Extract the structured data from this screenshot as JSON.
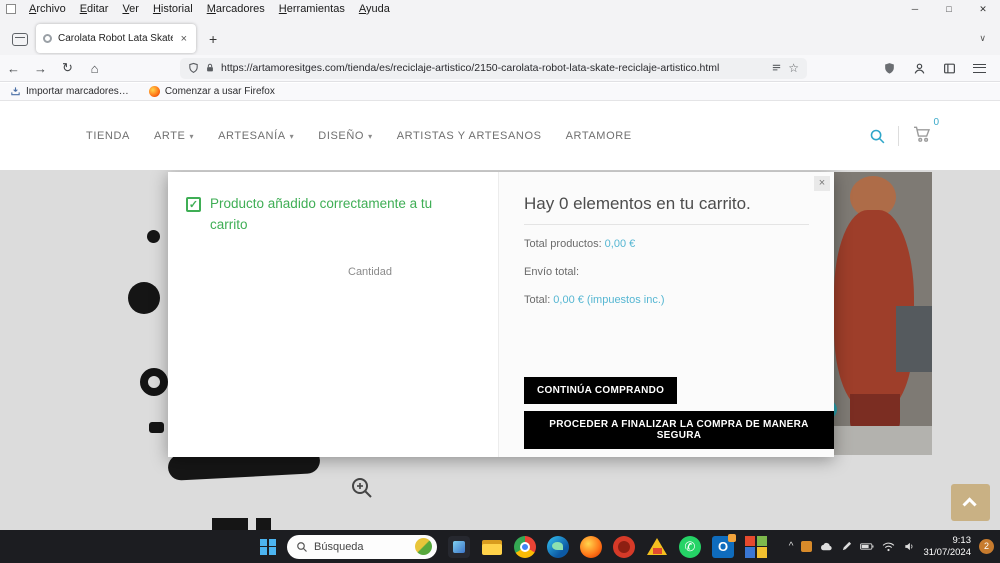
{
  "window": {
    "menu": [
      "Archivo",
      "Editar",
      "Ver",
      "Historial",
      "Marcadores",
      "Herramientas",
      "Ayuda"
    ],
    "controls": {
      "minimize": "─",
      "maximize": "□",
      "close": "✕"
    }
  },
  "browser": {
    "tab": {
      "title": "Carolata Robot Lata Skate Recic"
    },
    "url": "https://artamoresitges.com/tienda/es/reciclaje-artistico/2150-carolata-robot-lata-skate-reciclaje-artistico.html",
    "bookmarks": [
      {
        "label": "Importar marcadores…"
      },
      {
        "label": "Comenzar a usar Firefox"
      }
    ]
  },
  "site": {
    "nav": [
      {
        "label": "TIENDA",
        "caret": false
      },
      {
        "label": "ARTE",
        "caret": true
      },
      {
        "label": "ARTESANÍA",
        "caret": true
      },
      {
        "label": "DISEÑO",
        "caret": true
      },
      {
        "label": "ARTISTAS Y ARTESANOS",
        "caret": false
      },
      {
        "label": "ARTAMORE",
        "caret": false
      }
    ],
    "cart_count": "0"
  },
  "modal": {
    "success_message": "Producto añadido correctamente a tu carrito",
    "quantity_label": "Cantidad",
    "cart_title": "Hay 0 elementos en tu carrito.",
    "totals": [
      {
        "label": "Total productos:",
        "value": "0,00 €"
      },
      {
        "label": "Envío total:",
        "value": ""
      },
      {
        "label": "Total:",
        "value": "0,00 € (impuestos inc.)"
      }
    ],
    "continue_button": "CONTINÚA COMPRANDO",
    "checkout_button": "PROCEDER A FINALIZAR LA COMPRA DE MANERA SEGURA"
  },
  "taskbar": {
    "search_label": "Búsqueda",
    "time": "9:13",
    "date": "31/07/2024",
    "notification_count": "2"
  },
  "icons": {
    "back": "←",
    "forward": "→",
    "reload": "↻",
    "home": "⌂",
    "star": "☆",
    "plus": "+",
    "close": "×",
    "check": "✓",
    "caret": "▾",
    "tabs_chevron": "∨",
    "hidden_icons": "^"
  },
  "colors": {
    "accent_teal": "#55b6d2",
    "success_green": "#3fae55",
    "button_black": "#000000",
    "scrolltop_tan": "#c9b184",
    "taskbar_bg": "#1c1d21"
  }
}
